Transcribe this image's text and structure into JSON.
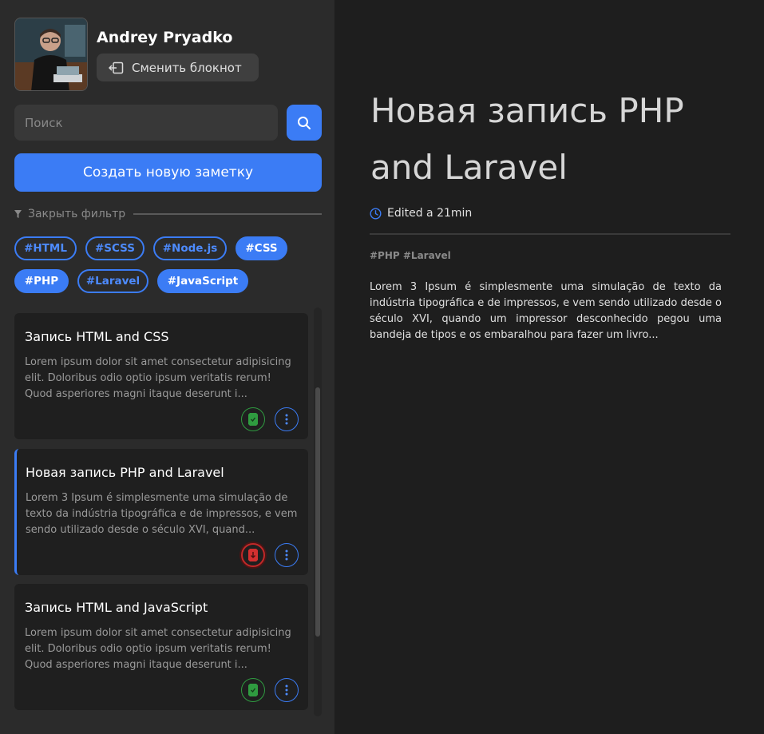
{
  "user": {
    "name": "Andrey Pryadko",
    "switch_label": "Сменить блокнот"
  },
  "search": {
    "placeholder": "Поиск"
  },
  "create_label": "Создать новую заметку",
  "filter": {
    "label": "Закрыть фильтр",
    "tags": [
      {
        "label": "#HTML",
        "active": false
      },
      {
        "label": "#SCSS",
        "active": false
      },
      {
        "label": "#Node.js",
        "active": false
      },
      {
        "label": "#CSS",
        "active": true
      },
      {
        "label": "#PHP",
        "active": true
      },
      {
        "label": "#Laravel",
        "active": false
      },
      {
        "label": "#JavaScript",
        "active": true
      }
    ]
  },
  "notes": [
    {
      "title": "Запись HTML and CSS",
      "body": "Lorem ipsum dolor sit amet consectetur adipisicing elit. Doloribus odio optio ipsum veritatis rerum! Quod asperiores magni itaque deserunt i...",
      "pinned": false,
      "selected": false
    },
    {
      "title": "Новая запись PHP and Laravel",
      "body": "Lorem 3 Ipsum é simplesmente uma simulação de texto da indústria tipográfica e de impressos, e vem sendo utilizado desde o século XVI, quand...",
      "pinned": true,
      "selected": true
    },
    {
      "title": "Запись HTML and JavaScript",
      "body": "Lorem ipsum dolor sit amet consectetur adipisicing elit. Doloribus odio optio ipsum veritatis rerum! Quod asperiores magni itaque deserunt i...",
      "pinned": false,
      "selected": false
    }
  ],
  "main": {
    "title": "Новая запись PHP and Laravel",
    "edited": "Edited a 21min",
    "tags": "#PHP #Laravel",
    "content": "Lorem 3 Ipsum é simplesmente uma simulação de texto da indústria tipográfica e de impressos, e vem sendo utilizado desde o século XVI, quando um impressor desconhecido pegou uma bandeja de tipos e os embaralhou para fazer um livro..."
  },
  "colors": {
    "accent": "#3b7cf5",
    "pin_green": "#2f9b40",
    "pin_red": "#c32828",
    "sidebar_bg": "#2b2b2b",
    "main_bg": "#1e1e1e"
  },
  "icons": {
    "switch": "notebook-switch-icon",
    "search": "search-icon",
    "filter": "filter-icon",
    "pin": "pin-icon",
    "more": "more-vertical-icon",
    "clock": "clock-icon"
  }
}
